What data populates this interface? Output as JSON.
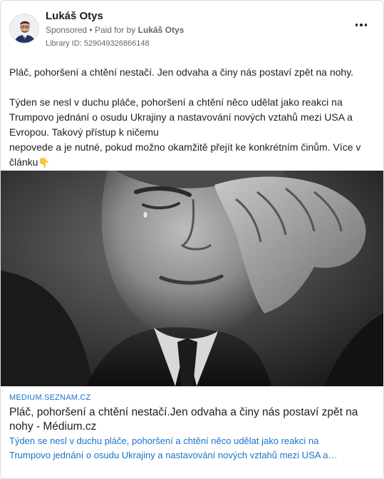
{
  "post": {
    "author": "Lukáš Otys",
    "sponsored_label": "Sponsored",
    "separator": "•",
    "paid_for_prefix": "Paid for by",
    "paid_for_name": "Lukáš Otys",
    "library_id": "Library ID: 529049326866148",
    "body": {
      "paragraph1": "Pláč, pohoršení a chtění nestačí. Jen odvaha a činy nás postaví zpět na nohy.",
      "paragraph2_line1": "Týden se nesl v duchu pláče, pohoršení a chtění něco udělat jako reakci na",
      "paragraph2_line2": "Trumpovo jednání o osudu Ukrajiny a nastavování nových vztahů mezi USA a",
      "paragraph2_line3": "Evropou. Takový přístup k ničemu",
      "paragraph2_line4": "nepovede a je nutné, pokud možno okamžitě přejít ke konkrétním činům. Více v",
      "paragraph2_line5": "článku",
      "emoji": "👇"
    }
  },
  "link_preview": {
    "domain": "MEDIUM.SEZNAM.CZ",
    "title": "Pláč, pohoršení a chtění nestačí.Jen odvaha a činy nás postaví zpět na nohy - Médium.cz",
    "description_line1": "Týden se nesl v duchu pláče, pohoršení a chtění něco udělat jako reakci na",
    "description_line2": "Trumpovo jednání o osudu Ukrajiny a nastavování nových vztahů mezi USA a…"
  },
  "colors": {
    "link_blue": "#1a73c7",
    "meta_gray": "#65676b",
    "text": "#1c1e21"
  },
  "icons": {
    "more": "more-options-icon"
  }
}
